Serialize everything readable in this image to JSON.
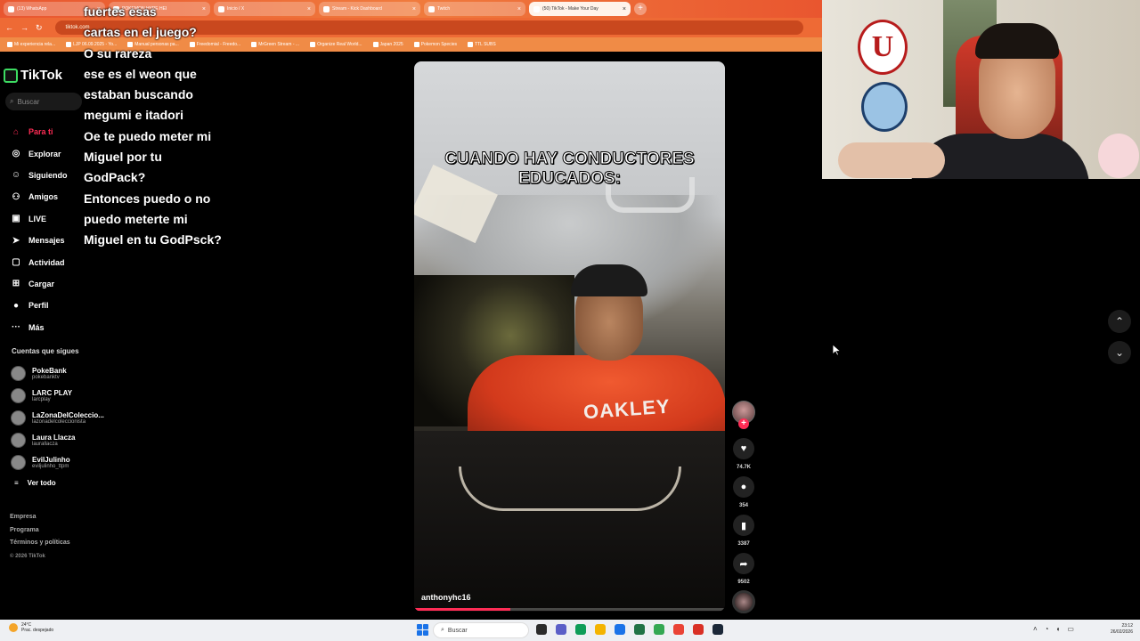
{
  "browser": {
    "tabs": [
      {
        "label": "(13) WhatsApp",
        "active": false
      },
      {
        "label": "POKEMON HYPE HEI",
        "active": false
      },
      {
        "label": "Inicio / X",
        "active": false
      },
      {
        "label": "Stream - Kick Dashboard",
        "active": false
      },
      {
        "label": "Twitch",
        "active": false
      },
      {
        "label": "(50) TikTok - Make Your Day",
        "active": true
      }
    ],
    "new_tab": "+",
    "url": "tiktok.com",
    "bookmarks": [
      "Mi experiencia rela...",
      "LJP 06.09.2025 - Yo...",
      "Manual personas pa...",
      "Freedomial - Freedo...",
      "MrGreen Stream - ...",
      "Organize Real World...",
      "Japan 2025",
      "Pokemon Species",
      "TTL SUBS"
    ]
  },
  "sidebar": {
    "logo": "TikTok",
    "search_placeholder": "Buscar",
    "nav": [
      {
        "label": "Para ti",
        "icon": "home-icon",
        "glyph": "⌂",
        "active": true
      },
      {
        "label": "Explorar",
        "icon": "compass-icon",
        "glyph": "◎",
        "active": false
      },
      {
        "label": "Siguiendo",
        "icon": "following-icon",
        "glyph": "☺",
        "active": false
      },
      {
        "label": "Amigos",
        "icon": "friends-icon",
        "glyph": "⚇",
        "active": false
      },
      {
        "label": "LIVE",
        "icon": "live-icon",
        "glyph": "▣",
        "active": false
      },
      {
        "label": "Mensajes",
        "icon": "messages-icon",
        "glyph": "➤",
        "active": false
      },
      {
        "label": "Actividad",
        "icon": "activity-icon",
        "glyph": "▢",
        "active": false
      },
      {
        "label": "Cargar",
        "icon": "upload-icon",
        "glyph": "⊞",
        "active": false
      },
      {
        "label": "Perfil",
        "icon": "profile-icon",
        "glyph": "●",
        "active": false
      },
      {
        "label": "Más",
        "icon": "more-icon",
        "glyph": "···",
        "active": false
      }
    ],
    "following_title": "Cuentas que sigues",
    "following": [
      {
        "name": "PokeBank",
        "handle": "pokebanktv"
      },
      {
        "name": "LARC PLAY",
        "handle": "larcplay"
      },
      {
        "name": "LaZonaDelColeccio...",
        "handle": "lazonadelcoleccionista"
      },
      {
        "name": "Laura Llacza",
        "handle": "laurallacza"
      },
      {
        "name": "EvilJulinho",
        "handle": "eviljulinho_ttpm"
      }
    ],
    "see_all": "Ver todo",
    "footer": [
      "Empresa",
      "Programa",
      "Términos y políticas"
    ],
    "copyright": "© 2026 TikTok"
  },
  "chat_overlay": [
    "fuertes esas",
    "cartas en el juego?",
    "O su rareza",
    "ese es el weon que estaban buscando",
    "megumi e itadori",
    "Oe te puedo meter mi Miguel por tu GodPack?",
    "Entonces puedo o no puedo meterte mi Miguel en tu GodPsck?"
  ],
  "video": {
    "caption": "CUANDO HAY CONDUCTORES EDUCADOS:",
    "shirt_text": "OAKLEY",
    "username": "anthonyhc16",
    "progress_fraction": 0.31
  },
  "actions": {
    "follow_plus": "+",
    "like_count": "74.7K",
    "comment_count": "354",
    "save_count": "3387",
    "share_count": "9502"
  },
  "scroll": {
    "up": "⌃",
    "down": "⌄"
  },
  "webcam": {
    "badge_letter": "U"
  },
  "taskbar": {
    "weather_temp": "24°C",
    "weather_desc": "Prac. despejado",
    "search_placeholder": "Buscar",
    "time": "23:12",
    "date": "26/02/2026",
    "app_colors": [
      "#2b2b2b",
      "#5b5fc7",
      "#0f9d58",
      "#f4b400",
      "#1a73e8",
      "#217346",
      "#34a853",
      "#ea4335",
      "#d93025",
      "#1b2838"
    ]
  }
}
